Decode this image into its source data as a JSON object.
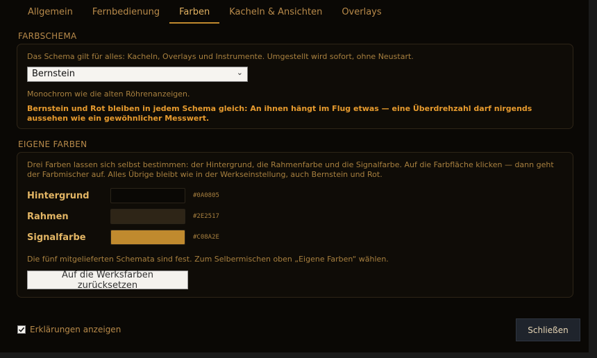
{
  "tabs": [
    {
      "label": "Allgemein"
    },
    {
      "label": "Fernbedienung"
    },
    {
      "label": "Farben"
    },
    {
      "label": "Kacheln & Ansichten"
    },
    {
      "label": "Overlays"
    }
  ],
  "active_tab": "Farben",
  "farbschema": {
    "title": "FARBSCHEMA",
    "description": "Das Schema gilt für alles: Kacheln, Overlays und Instrumente. Umgestellt wird sofort, ohne Neustart.",
    "selected": "Bernstein",
    "hint": "Monochrom wie die alten Röhrenanzeigen.",
    "warning": "Bernstein und Rot bleiben in jedem Schema gleich: An ihnen hängt im Flug etwas — eine Überdrehzahl darf nirgends aussehen wie ein gewöhnlicher Messwert."
  },
  "eigene_farben": {
    "title": "EIGENE FARBEN",
    "description": "Drei Farben lassen sich selbst bestimmen: der Hintergrund, die Rahmenfarbe und die Signalfarbe. Auf die Farbfläche klicken — dann geht der Farbmischer auf. Alles Übrige bleibt wie in der Werkseinstellung, auch Bernstein und Rot.",
    "colors": [
      {
        "label": "Hintergrund",
        "hex": "#0A0805",
        "value": "#0a0805"
      },
      {
        "label": "Rahmen",
        "hex": "#2E2517",
        "value": "#2e2517"
      },
      {
        "label": "Signalfarbe",
        "hex": "#C08A2E",
        "value": "#c08a2e"
      }
    ],
    "note": "Die fünf mitgelieferten Schemata sind fest. Zum Selbermischen oben „Eigene Farben“ wählen.",
    "reset_label": "Auf die Werksfarben zurücksetzen"
  },
  "footer": {
    "show_explanations_label": "Erklärungen anzeigen",
    "show_explanations_checked": true,
    "close_label": "Schließen"
  }
}
